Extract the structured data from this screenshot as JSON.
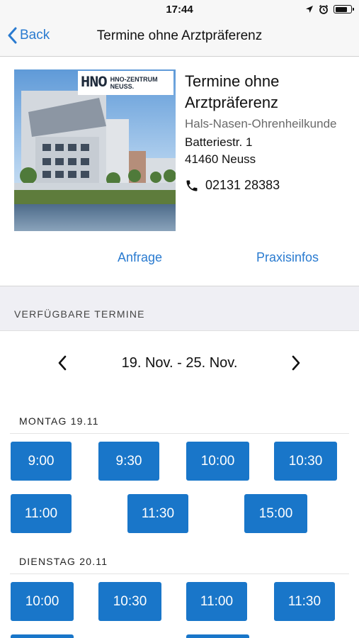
{
  "status": {
    "time": "17:44"
  },
  "nav": {
    "back_label": "Back",
    "title": "Termine ohne Arztpräferenz"
  },
  "practice": {
    "logo_mark": "HNO",
    "logo_text_line1": "HNO-ZENTRUM",
    "logo_text_line2": "NEUSS.",
    "name": "Termine ohne Arztpräferenz",
    "specialty": "Hals-Nasen-Ohrenheilkunde",
    "street": "Batteriestr. 1",
    "city": "41460 Neuss",
    "phone": "02131 28383"
  },
  "actions": {
    "request": "Anfrage",
    "info": "Praxisinfos"
  },
  "appointments": {
    "section_title": "VERFÜGBARE TERMINE",
    "week_range": "19. Nov. - 25. Nov.",
    "days": [
      {
        "label": "MONTAG 19.11",
        "slots": [
          "9:00",
          "9:30",
          "10:00",
          "10:30",
          "11:00",
          "11:30",
          "15:00"
        ]
      },
      {
        "label": "DIENSTAG 20.11",
        "slots": [
          "10:00",
          "10:30",
          "11:00",
          "11:30"
        ]
      }
    ]
  },
  "colors": {
    "accent": "#2a7bd0",
    "slot": "#1976c9",
    "nav_background": "#f7f7f7",
    "section_background": "#efeff4"
  }
}
